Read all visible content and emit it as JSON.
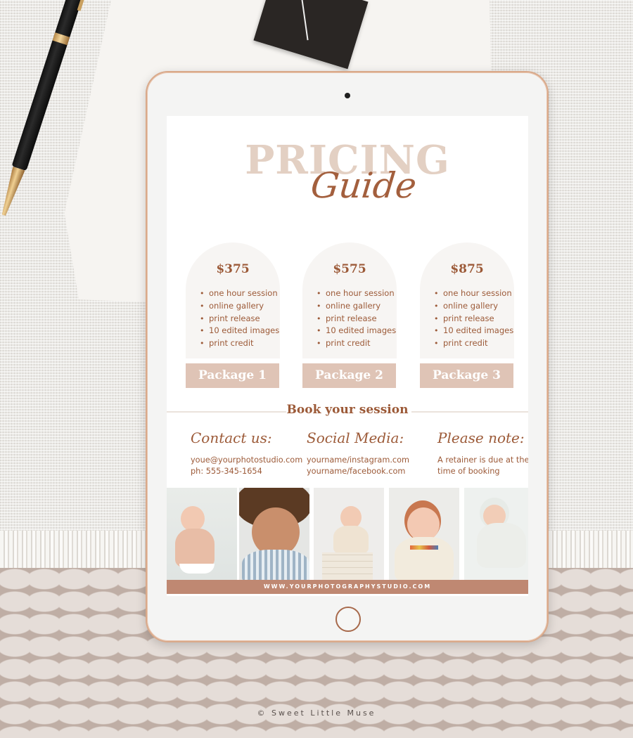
{
  "header": {
    "title_main": "PRICING",
    "title_script": "Guide"
  },
  "packages": [
    {
      "price": "$375",
      "features": [
        "one hour session",
        "online gallery",
        "print release",
        "10 edited images",
        "print credit"
      ],
      "button_label": "Package 1"
    },
    {
      "price": "$575",
      "features": [
        "one hour session",
        "online gallery",
        "print release",
        "10 edited images",
        "print credit"
      ],
      "button_label": "Package 2"
    },
    {
      "price": "$875",
      "features": [
        "one hour session",
        "online gallery",
        "print release",
        "10 edited images",
        "print credit"
      ],
      "button_label": "Package 3"
    }
  ],
  "booking": {
    "title": "Book your session",
    "contact": {
      "heading": "Contact us:",
      "email": "youe@yourphotostudio.com",
      "phone": "ph: 555-345-1654"
    },
    "social": {
      "heading": "Social Media:",
      "instagram": "yourname/instagram.com",
      "facebook": "yourname/facebook.com"
    },
    "note": {
      "heading": "Please note:",
      "line1": "A retainer is due at the",
      "line2": "time of booking"
    }
  },
  "photos": [
    {
      "subject": "baby sitting in bowl"
    },
    {
      "subject": "curly-haired toddler"
    },
    {
      "subject": "baby in wooden box"
    },
    {
      "subject": "smiling baby with headband"
    },
    {
      "subject": "sleeping newborn in bonnet"
    }
  ],
  "footer": {
    "website": "WWW.YOURPHOTOGRAPHYSTUDIO.COM"
  },
  "watermark": "© Sweet Little Muse",
  "colors": {
    "accent_brown": "#9c5a38",
    "title_beige": "#e3d0c3",
    "button_beige": "#dfc4b6",
    "footer_terracotta": "#bf8872",
    "tablet_rose_gold": "#d9a98a"
  }
}
